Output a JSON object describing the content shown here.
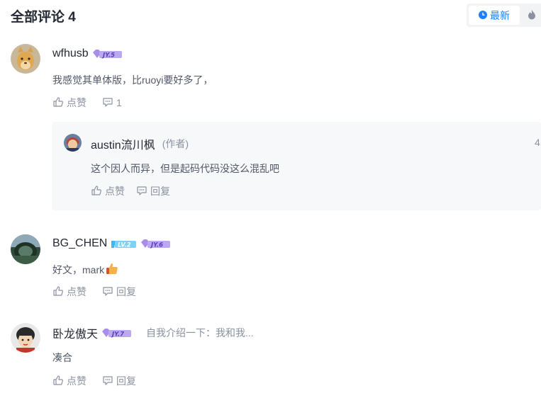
{
  "header": {
    "title": "全部评论 4",
    "sort_latest": "最新"
  },
  "comments": [
    {
      "username": "wfhusb",
      "badge": "JY.5",
      "content": "我感觉其单体版，比ruoyi要好多了，",
      "like_label": "点赞",
      "reply_count": "1",
      "reply": {
        "username": "austin流川枫",
        "author_tag": "(作者)",
        "time": "4",
        "content": "这个因人而异，但是起码代码没这么混乱吧",
        "like_label": "点赞",
        "reply_label": "回复"
      }
    },
    {
      "username": "BG_CHEN",
      "level_badge": "LV.2",
      "badge": "JY.6",
      "content": "好文，mark",
      "like_label": "点赞",
      "reply_label": "回复"
    },
    {
      "username": "卧龙傲天",
      "badge": "JY.7",
      "intro": "自我介绍一下：我和我...",
      "content": "凑合",
      "like_label": "点赞",
      "reply_label": "回复"
    }
  ],
  "colors": {
    "accent": "#1e80ff",
    "jy_badge": "#a98ee9",
    "lv_badge": "#3eb6ef"
  },
  "icons": [
    "clock-icon",
    "flame-icon",
    "thumb-up-icon",
    "comment-icon",
    "thumbs-up-emoji"
  ]
}
